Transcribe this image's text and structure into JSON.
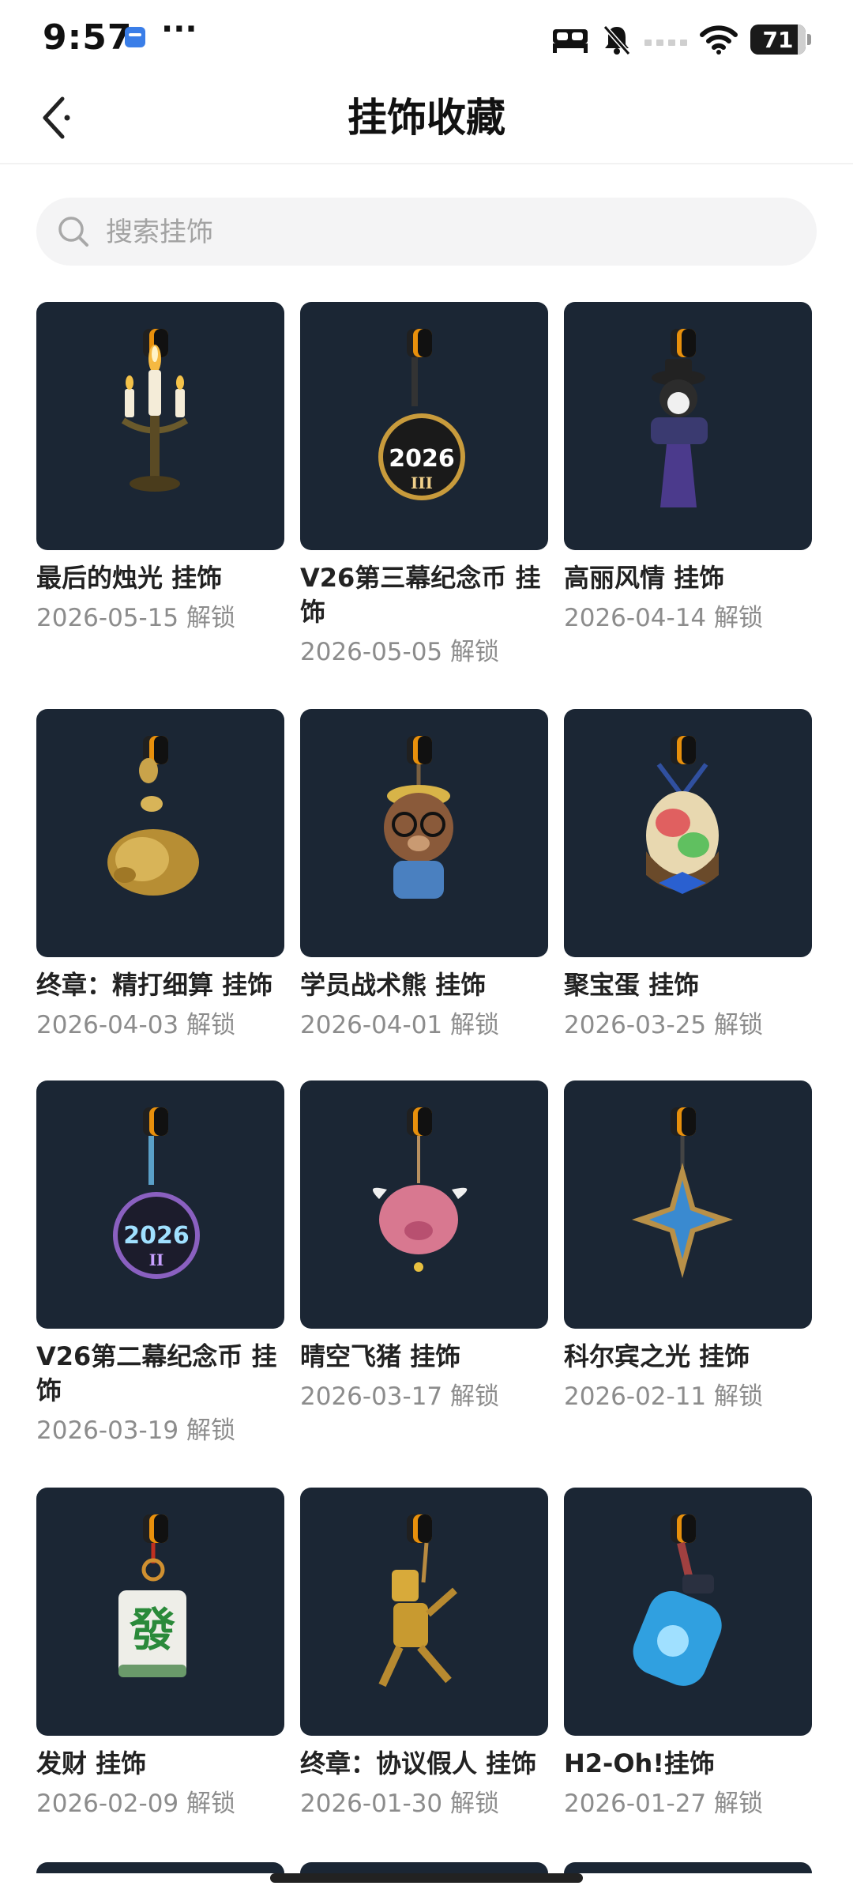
{
  "status_bar": {
    "time": "9:57",
    "dots": "···",
    "battery": "71"
  },
  "header": {
    "title": "挂饰收藏",
    "back_icon": "chevron-left-icon"
  },
  "search": {
    "placeholder": "搜索挂饰",
    "icon": "search-icon"
  },
  "items": [
    {
      "name": "最后的烛光 挂饰",
      "date": "2026-05-15 解锁"
    },
    {
      "name": "V26第三幕纪念币 挂饰",
      "date": "2026-05-05 解锁"
    },
    {
      "name": "高丽风情 挂饰",
      "date": "2026-04-14 解锁"
    },
    {
      "name": "终章：精打细算 挂饰",
      "date": "2026-04-03 解锁"
    },
    {
      "name": "学员战术熊 挂饰",
      "date": "2026-04-01 解锁"
    },
    {
      "name": "聚宝蛋 挂饰",
      "date": "2026-03-25 解锁"
    },
    {
      "name": "V26第二幕纪念币 挂饰",
      "date": "2026-03-19 解锁"
    },
    {
      "name": "晴空飞猪 挂饰",
      "date": "2026-03-17 解锁"
    },
    {
      "name": "科尔宾之光 挂饰",
      "date": "2026-02-11 解锁"
    },
    {
      "name": "发财 挂饰",
      "date": "2026-02-09 解锁"
    },
    {
      "name": "终章：协议假人 挂饰",
      "date": "2026-01-30 解锁"
    },
    {
      "name": "H2-Oh!挂饰",
      "date": "2026-01-27 解锁"
    }
  ],
  "charm_texts": {
    "coin_act3": "2026",
    "coin_act3_sub": "III",
    "coin_act2": "2026",
    "coin_act2_sub": "II",
    "mahjong": "發"
  },
  "colors": {
    "thumb_bg": "#1b2634",
    "clip_orange": "#e8900c"
  }
}
